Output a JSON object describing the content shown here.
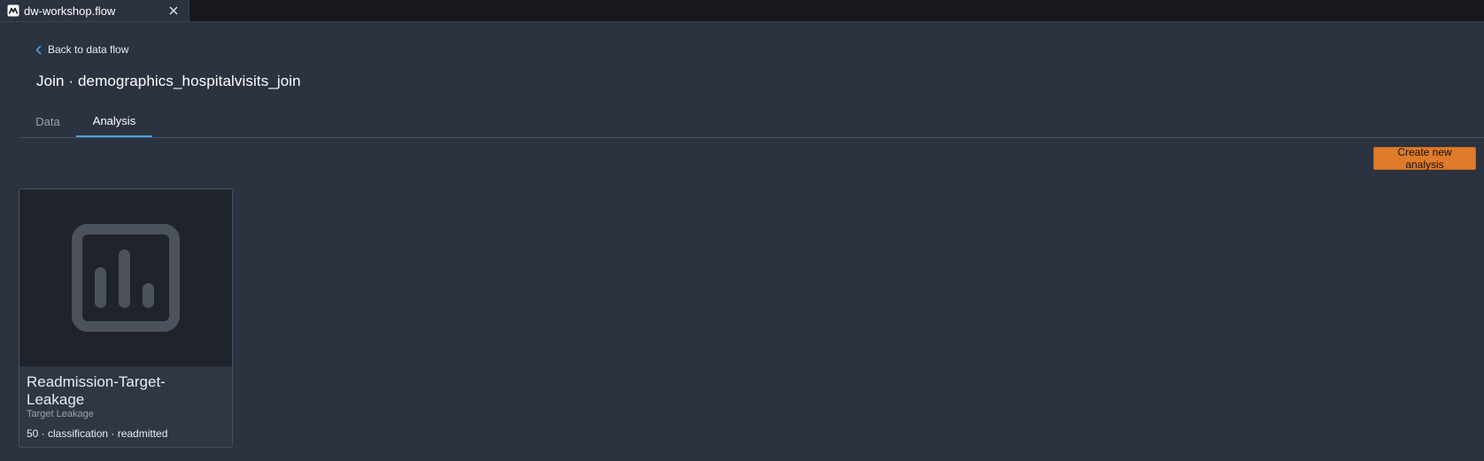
{
  "window": {
    "tab_title": "dw-workshop.flow",
    "tab_icon": "data-wrangler-flow-icon",
    "close_icon": "close-icon"
  },
  "header": {
    "back_label": "Back to data flow",
    "title": "Join · demographics_hospitalvisits_join"
  },
  "tabs": [
    {
      "label": "Data",
      "active": false
    },
    {
      "label": "Analysis",
      "active": true
    }
  ],
  "toolbar": {
    "create_label": "Create new analysis"
  },
  "analyses": [
    {
      "title": "Readmission-Target-Leakage",
      "subtitle": "Target Leakage",
      "meta": "50 · classification · readmitted",
      "icon": "bar-chart-icon"
    }
  ],
  "colors": {
    "background": "#2b3240",
    "tabbar": "#16181d",
    "accent_tab": "#4aa3e0",
    "primary_button": "#e07b2a",
    "card_thumb": "#1f242c",
    "icon_gray": "#4c525c"
  }
}
